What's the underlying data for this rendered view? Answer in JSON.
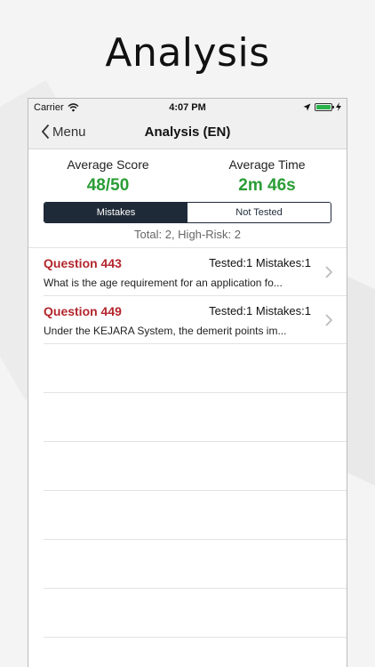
{
  "promo": {
    "title": "Analysis"
  },
  "status_bar": {
    "carrier": "Carrier",
    "time": "4:07 PM"
  },
  "nav": {
    "back_label": "Menu",
    "title": "Analysis (EN)"
  },
  "stats": {
    "average_score_label": "Average Score",
    "average_score_value": "48/50",
    "average_time_label": "Average Time",
    "average_time_value": "2m 46s"
  },
  "tabs": [
    {
      "label": "Mistakes",
      "selected": true
    },
    {
      "label": "Not Tested",
      "selected": false
    }
  ],
  "summary": "Total: 2, High-Risk: 2",
  "questions": [
    {
      "title": "Question 443",
      "stats": "Tested:1 Mistakes:1",
      "text": "What is the age requirement for an application fo..."
    },
    {
      "title": "Question 449",
      "stats": "Tested:1 Mistakes:1",
      "text": "Under the KEJARA System, the demerit points im..."
    }
  ],
  "colors": {
    "accent_green": "#2a9d36",
    "question_red": "#b3262d",
    "segment_dark": "#1f2a38",
    "battery_green": "#2bb24c"
  }
}
